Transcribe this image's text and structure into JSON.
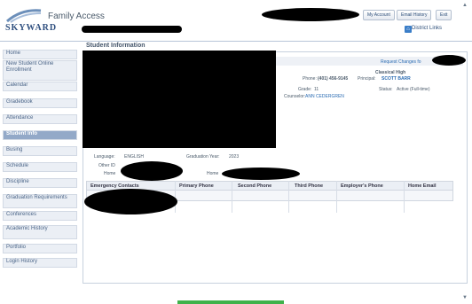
{
  "header": {
    "app_title": "Family Access",
    "logo_text": "SKYWARD",
    "links": [
      "My Account",
      "Email History",
      "Exit"
    ],
    "district_links": "District Links"
  },
  "sidebar": {
    "items": [
      {
        "label": "Home"
      },
      {
        "label": "New Student Online Enrollment"
      },
      {
        "label": "Calendar"
      },
      {
        "label": "Gradebook"
      },
      {
        "label": "Attendance"
      },
      {
        "label": "Student Info"
      },
      {
        "label": "Busing"
      },
      {
        "label": "Schedule"
      },
      {
        "label": "Discipline"
      },
      {
        "label": "Graduation Requirements"
      },
      {
        "label": "Conferences"
      },
      {
        "label": "Academic History"
      },
      {
        "label": "Portfolio"
      },
      {
        "label": "Login History"
      }
    ],
    "active_index": 5
  },
  "main": {
    "title": "Student Information",
    "request_changes": "Request Changes fo",
    "school_name": "Classical High",
    "phone_label": "Phone:",
    "phone_value": "(401) 456-9145",
    "principal_label": "Principal:",
    "principal_value": "SCOTT BARR",
    "grade_label": "Grade:",
    "grade_value": "11",
    "status_label": "Status:",
    "status_value": "Active (Full-time)",
    "counselor_label": "Counselor:",
    "counselor_value": "ANN CEDERGREN",
    "language_label": "Language:",
    "language_value": "ENGLISH",
    "graduation_label": "Graduation Year:",
    "graduation_value": "2023",
    "other_id_label": "Other ID",
    "home_label": "Home",
    "home2_label": "Home"
  },
  "contacts_table": {
    "headers": [
      "Emergency Contacts",
      "Primary Phone",
      "Second Phone",
      "Third Phone",
      "Employer's Phone",
      "Home Email"
    ]
  }
}
